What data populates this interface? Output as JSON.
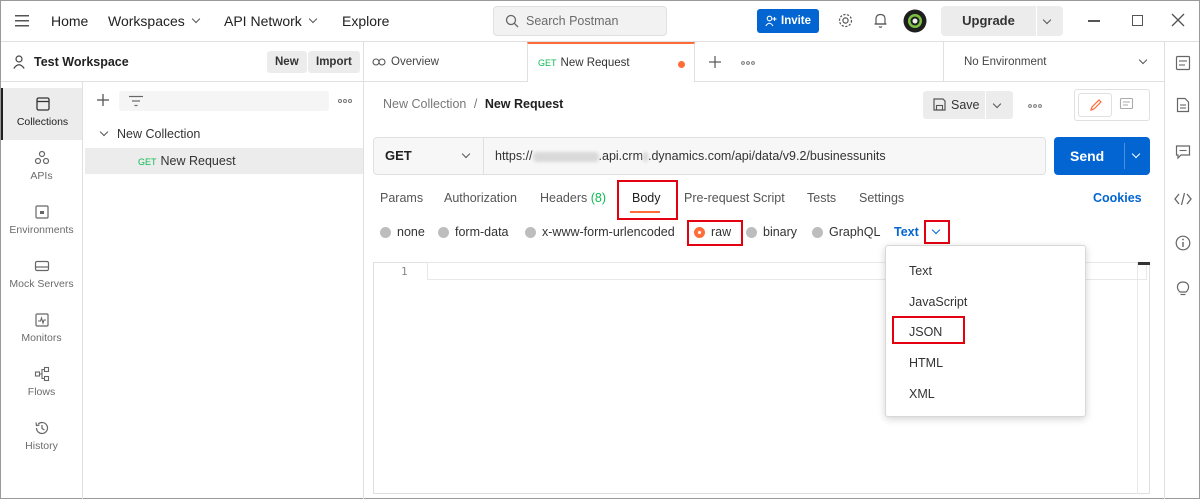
{
  "topbar": {
    "home": "Home",
    "workspaces": "Workspaces",
    "api_network": "API Network",
    "explore": "Explore",
    "search_placeholder": "Search Postman",
    "invite": "Invite",
    "upgrade": "Upgrade"
  },
  "workspace": {
    "name": "Test Workspace",
    "new_label": "New",
    "import_label": "Import"
  },
  "rail": [
    {
      "label": "Collections",
      "icon": "collections-icon"
    },
    {
      "label": "APIs",
      "icon": "apis-icon"
    },
    {
      "label": "Environments",
      "icon": "environments-icon"
    },
    {
      "label": "Mock Servers",
      "icon": "mock-servers-icon"
    },
    {
      "label": "Monitors",
      "icon": "monitors-icon"
    },
    {
      "label": "Flows",
      "icon": "flows-icon"
    },
    {
      "label": "History",
      "icon": "history-icon"
    }
  ],
  "sidebar": {
    "collection_name": "New Collection",
    "request_method": "GET",
    "request_name": "New Request"
  },
  "tabs": {
    "overview": "Overview",
    "active_method": "GET",
    "active_name": "New Request",
    "environment": "No Environment"
  },
  "request": {
    "breadcrumb_parent": "New Collection",
    "breadcrumb_sep": "/",
    "breadcrumb_current": "New Request",
    "save_label": "Save",
    "method": "GET",
    "url_prefix": "https://",
    "url_middle": ".api.crm",
    "url_suffix": ".dynamics.com/api/data/v9.2/businessunits",
    "send_label": "Send"
  },
  "subtabs": {
    "params": "Params",
    "authorization": "Authorization",
    "headers": "Headers",
    "headers_count": "(8)",
    "body": "Body",
    "pre_request": "Pre-request Script",
    "tests": "Tests",
    "settings": "Settings",
    "cookies": "Cookies"
  },
  "body_types": {
    "none": "none",
    "form_data": "form-data",
    "urlencoded": "x-www-form-urlencoded",
    "raw": "raw",
    "binary": "binary",
    "graphql": "GraphQL",
    "format_selected": "Text"
  },
  "editor": {
    "line_number": "1"
  },
  "format_menu": [
    "Text",
    "JavaScript",
    "JSON",
    "HTML",
    "XML"
  ],
  "colors": {
    "accent_blue": "#0265d2",
    "highlight_red": "#e3000f",
    "get_green": "#0cbb52",
    "unsaved_orange": "#ff6c37"
  }
}
